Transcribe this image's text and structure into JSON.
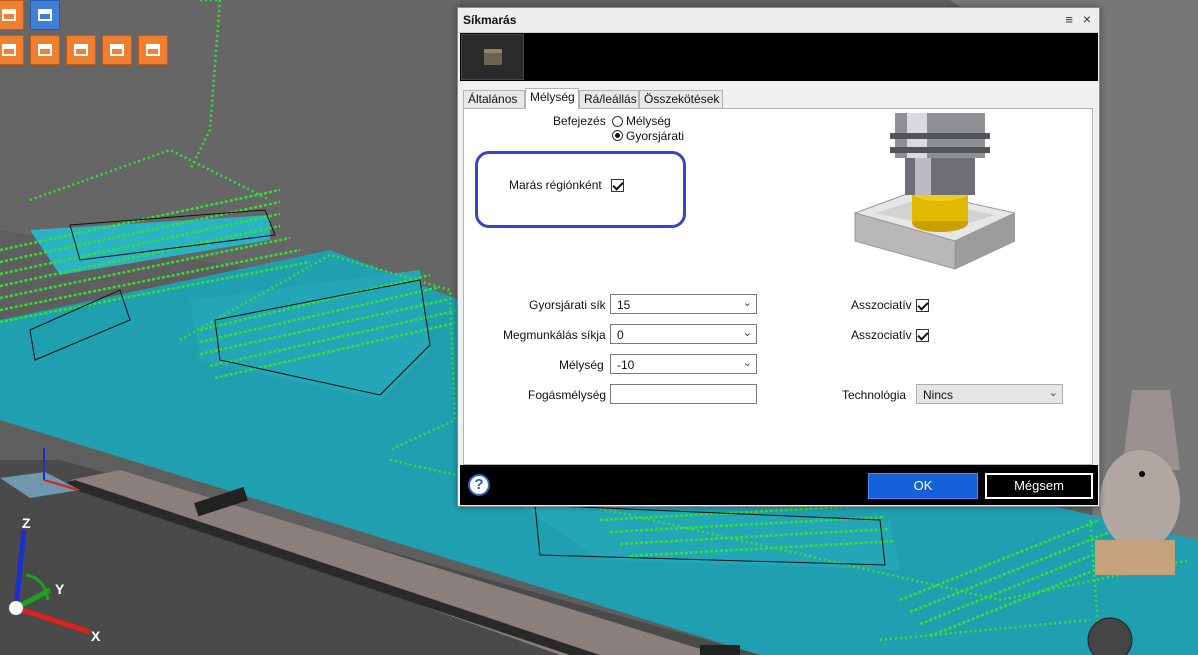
{
  "dialog": {
    "title": "Síkmarás",
    "menu_icon": "menu-icon",
    "close_icon": "×"
  },
  "tabs": [
    {
      "label": "Általános",
      "active": false
    },
    {
      "label": "Mélység",
      "active": true
    },
    {
      "label": "Rá/leállás",
      "active": false
    },
    {
      "label": "Összekötések",
      "active": false
    }
  ],
  "finish": {
    "label": "Befejezés",
    "options": [
      {
        "label": "Mélység",
        "selected": false
      },
      {
        "label": "Gyorsjárati",
        "selected": true
      }
    ]
  },
  "region_milling": {
    "label": "Marás régiónként",
    "checked": true
  },
  "fields": {
    "rapid_plane": {
      "label": "Gyorsjárati sík",
      "value": "15"
    },
    "machining_plane": {
      "label": "Megmunkálás síkja",
      "value": "0"
    },
    "depth": {
      "label": "Mélység",
      "value": "-10"
    },
    "step_depth": {
      "label": "Fogásmélység",
      "value": ""
    }
  },
  "associative": [
    {
      "label": "Asszociatív",
      "checked": true
    },
    {
      "label": "Asszociatív",
      "checked": true
    }
  ],
  "technology": {
    "label": "Technológia",
    "value": "Nincs"
  },
  "buttons": {
    "ok": "OK",
    "cancel": "Mégsem",
    "help": "?"
  },
  "axes": {
    "x": "X",
    "y": "Y",
    "z": "Z"
  },
  "colors": {
    "accent": "#1660d8",
    "toolpath": "#33e033",
    "stock": "#1f9fb0",
    "highlight": "#3a45c6"
  }
}
